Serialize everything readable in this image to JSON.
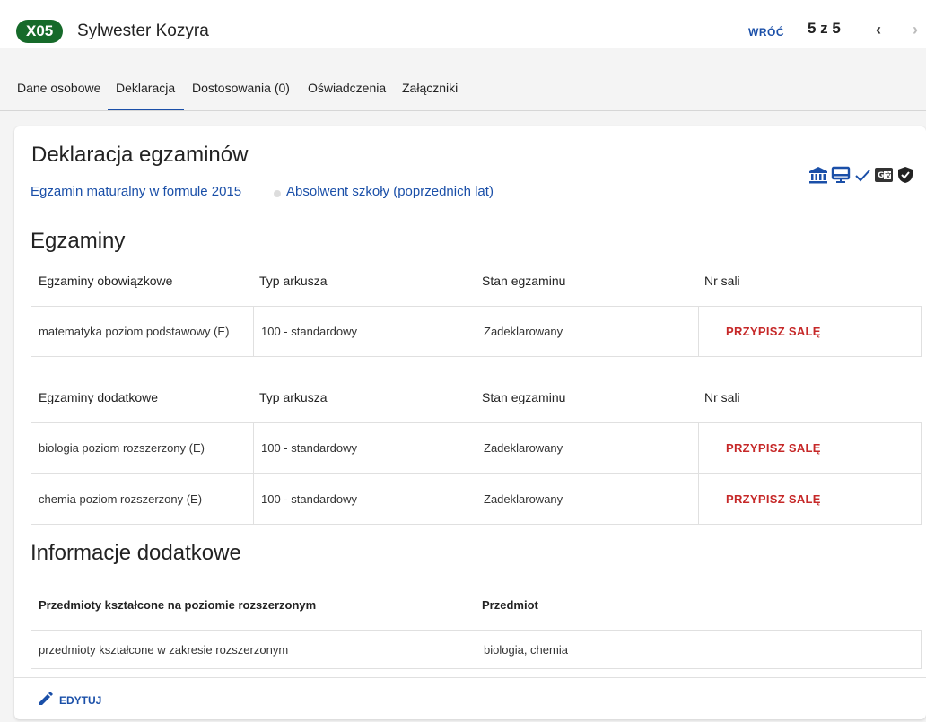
{
  "header": {
    "badge": "X05",
    "student_name": "Sylwester Kozyra",
    "back_label": "WRÓĆ",
    "pager": "5 z 5",
    "prev_icon": "‹",
    "next_icon": "›"
  },
  "tabs": [
    {
      "label": "Dane osobowe"
    },
    {
      "label": "Deklaracja"
    },
    {
      "label": "Dostosowania (0)"
    },
    {
      "label": "Oświadczenia"
    },
    {
      "label": "Załączniki"
    }
  ],
  "declaration": {
    "title": "Deklaracja egzaminów",
    "exam_type": "Egzamin maturalny w formule 2015",
    "graduate_type": "Absolwent szkoły (poprzednich lat)",
    "status_icons": [
      "institution-icon",
      "monitor-icon",
      "check-icon",
      "translate-icon",
      "shield-check-icon"
    ]
  },
  "exams": {
    "title": "Egzaminy",
    "mandatory": {
      "headers": [
        "Egzaminy obowiązkowe",
        "Typ arkusza",
        "Stan egzaminu",
        "Nr sali"
      ],
      "rows": [
        {
          "subject": "matematyka poziom podstawowy (E)",
          "sheet": "100 - standardowy",
          "state": "Zadeklarowany",
          "action": "PRZYPISZ SALĘ"
        }
      ]
    },
    "additional": {
      "headers": [
        "Egzaminy dodatkowe",
        "Typ arkusza",
        "Stan egzaminu",
        "Nr sali"
      ],
      "rows": [
        {
          "subject": "biologia poziom rozszerzony (E)",
          "sheet": "100 - standardowy",
          "state": "Zadeklarowany",
          "action": "PRZYPISZ SALĘ"
        },
        {
          "subject": "chemia poziom rozszerzony (E)",
          "sheet": "100 - standardowy",
          "state": "Zadeklarowany",
          "action": "PRZYPISZ SALĘ"
        }
      ]
    }
  },
  "additional_info": {
    "title": "Informacje dodatkowe",
    "headers": [
      "Przedmioty kształcone na poziomie rozszerzonym",
      "Przedmiot"
    ],
    "rows": [
      {
        "label": "przedmioty kształcone w zakresie rozszerzonym",
        "value": "biologia, chemia"
      }
    ]
  },
  "footer": {
    "edit_label": "EDYTUJ"
  },
  "colors": {
    "accent": "#1a4fa8",
    "badge": "#166a2a",
    "action": "#c62828"
  }
}
